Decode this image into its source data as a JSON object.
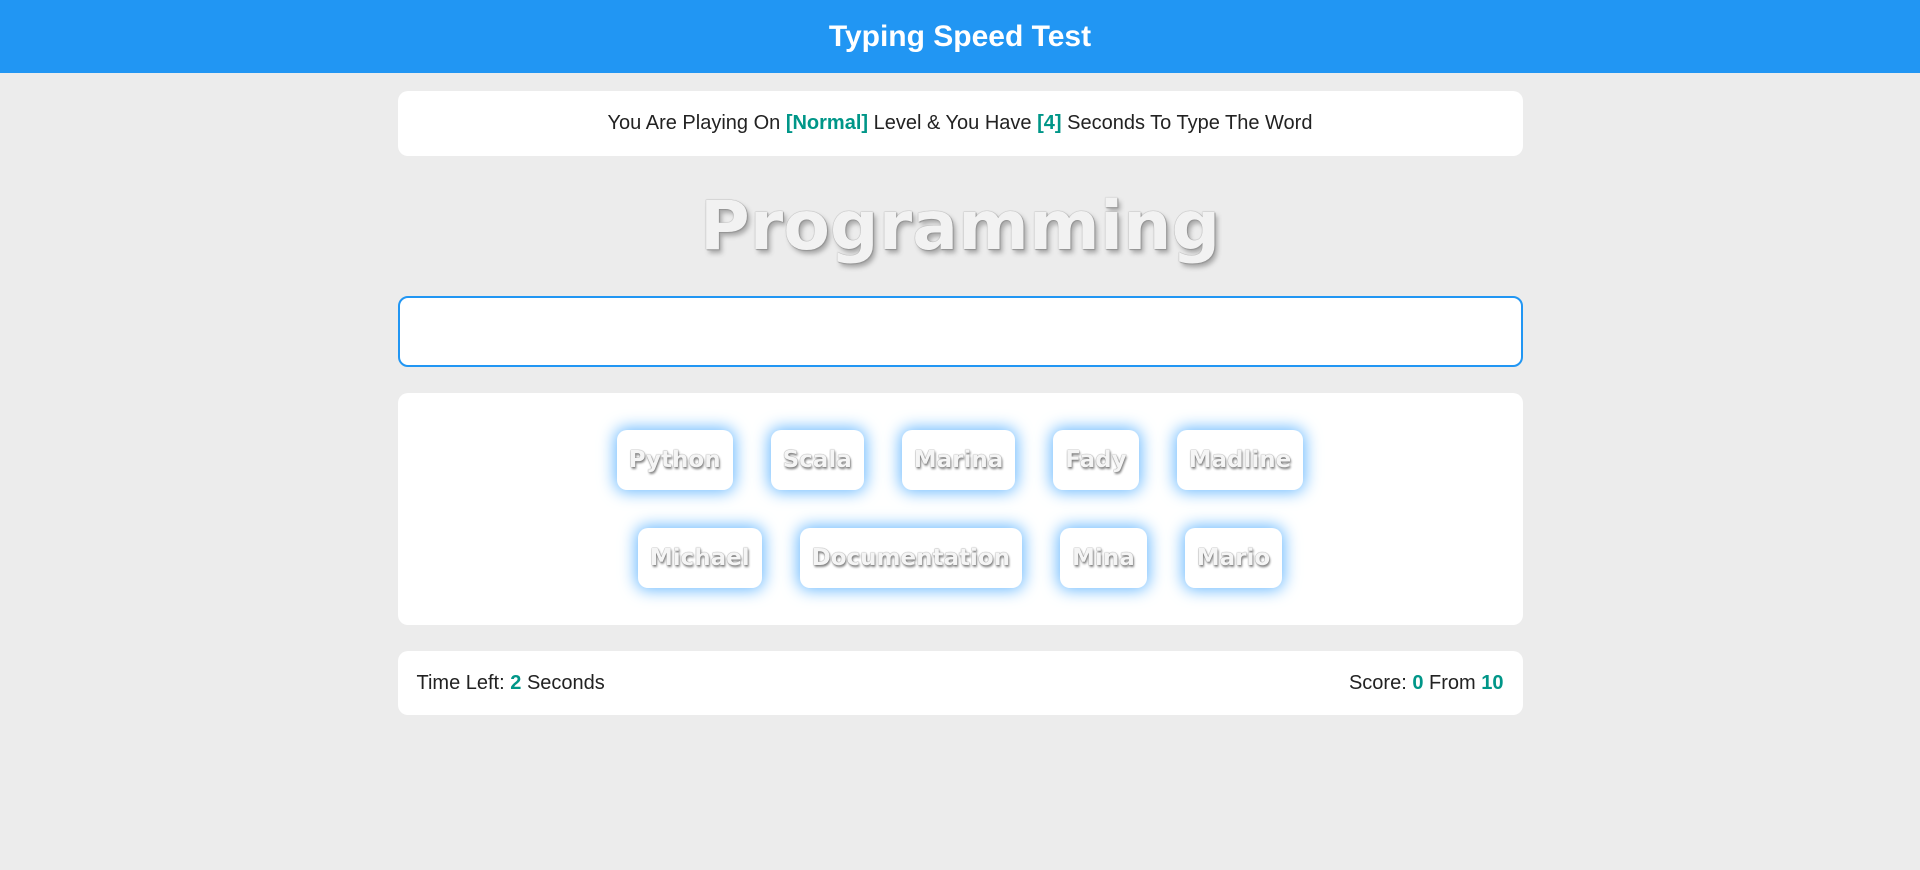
{
  "header": {
    "title": "Typing Speed Test"
  },
  "message": {
    "prefix": "You Are Playing On",
    "level": "[Normal]",
    "middle": "Level & You Have",
    "seconds": "[4]",
    "suffix": "Seconds To Type The Word"
  },
  "current_word": "Programming",
  "input": {
    "value": "",
    "placeholder": ""
  },
  "upcoming_words": [
    "Python",
    "Scala",
    "Marina",
    "Fady",
    "Madline",
    "Michael",
    "Documentation",
    "Mina",
    "Mario"
  ],
  "control": {
    "time_label": "Time Left:",
    "time_value": "2",
    "time_unit": "Seconds",
    "score_label": "Score:",
    "score_value": "0",
    "score_from": "From",
    "score_total": "10"
  },
  "colors": {
    "accent": "#2196f3",
    "highlight": "#009688",
    "background": "#ececec"
  }
}
